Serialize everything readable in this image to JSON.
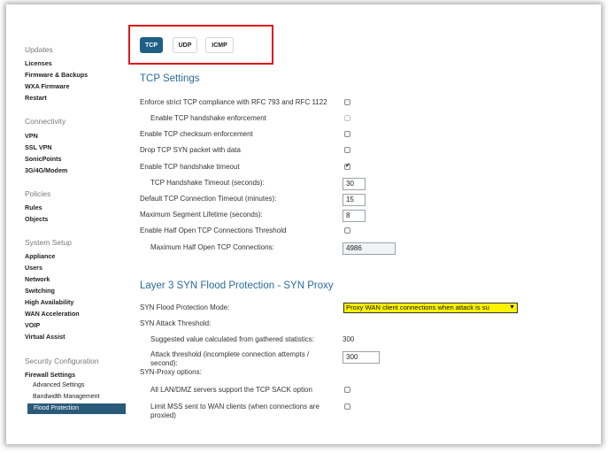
{
  "sidebar": {
    "updates": {
      "title": "Updates",
      "items": [
        "Licenses",
        "Firmware & Backups",
        "WXA Firmware",
        "Restart"
      ]
    },
    "connectivity": {
      "title": "Connectivity",
      "items": [
        "VPN",
        "SSL VPN",
        "SonicPoints",
        "3G/4G/Modem"
      ]
    },
    "policies": {
      "title": "Policies",
      "items": [
        "Rules",
        "Objects"
      ]
    },
    "system_setup": {
      "title": "System Setup",
      "items": [
        "Appliance",
        "Users",
        "Network",
        "Switching",
        "High Availability",
        "WAN Acceleration",
        "VOIP",
        "Virtual Assist"
      ]
    },
    "security": {
      "title": "Security Configuration",
      "items": [
        "Firewall Settings"
      ],
      "subitems": [
        "Advanced Settings",
        "Bandwidth Management",
        "Flood Protection"
      ]
    }
  },
  "tabs": [
    "TCP",
    "UDP",
    "ICMP"
  ],
  "tcp": {
    "title": "TCP Settings",
    "enforce_strict": "Enforce strict TCP compliance with RFC 793 and RFC 1122",
    "handshake_enforcement": "Enable TCP handshake enforcement",
    "checksum": "Enable TCP checksum enforcement",
    "drop_syn": "Drop TCP SYN packet with data",
    "handshake_timeout_enable": "Enable TCP handshake timeout",
    "handshake_timeout_label": "TCP Handshake Timeout (seconds):",
    "handshake_timeout_value": "30",
    "conn_timeout_label": "Default TCP Connection Timeout (minutes):",
    "conn_timeout_value": "15",
    "msl_label": "Maximum Segment Lifetime (seconds):",
    "msl_value": "8",
    "half_open_enable": "Enable Half Open TCP Connections Threshold",
    "half_open_max_label": "Maximum Half Open TCP Connections:",
    "half_open_max_value": "4986"
  },
  "syn": {
    "title": "Layer 3 SYN Flood Protection - SYN Proxy",
    "mode_label": "SYN Flood Protection Mode:",
    "mode_value": "Proxy WAN client connections when attack is su",
    "threshold_heading": "SYN Attack Threshold:",
    "suggested_label": "Suggested value calculated from gathered statistics:",
    "suggested_value": "300",
    "attack_threshold_label_1": "Attack threshold (incomplete connection attempts /",
    "attack_threshold_label_2": "second):",
    "attack_threshold_value": "300",
    "proxy_options": "SYN-Proxy options:",
    "sack_option": "All LAN/DMZ servers support the TCP SACK option",
    "limit_mss_1": "Limit MSS sent to WAN clients (when connections are",
    "limit_mss_2": "proxied)"
  },
  "colors": {
    "accent": "#1f5f85",
    "heading": "#2a6a9a",
    "highlight": "#fff200",
    "annotation": "#e0161d"
  }
}
